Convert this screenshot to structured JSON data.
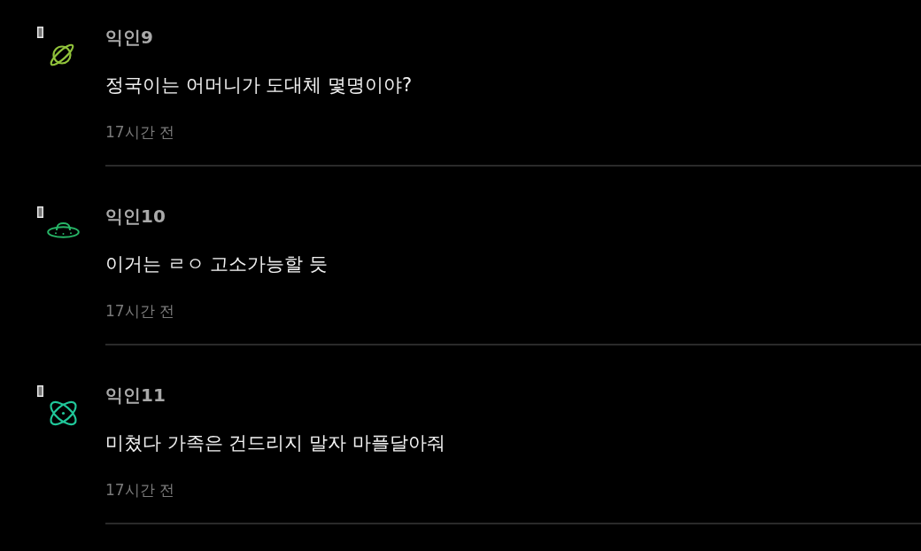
{
  "comments": [
    {
      "author": "익인9",
      "kind": "planet",
      "color": "#91c33b",
      "text": "정국이는 어머니가 도대체 몇명이야?",
      "time": "17시간 전"
    },
    {
      "author": "익인10",
      "kind": "ufo",
      "color": "#27b567",
      "text": "이거는 ㄹㅇ 고소가능할 듯",
      "time": "17시간 전"
    },
    {
      "author": "익인11",
      "kind": "atom",
      "color": "#20c79a",
      "text": "미쳤다 가족은 건드리지 말자 마플달아줘",
      "time": "17시간 전"
    }
  ]
}
